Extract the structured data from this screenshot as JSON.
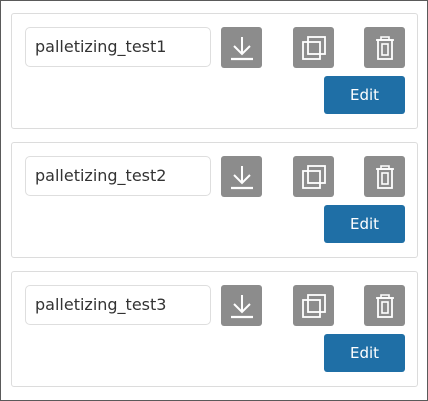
{
  "colors": {
    "icon_button_bg": "#8c8c8c",
    "edit_button_bg": "#1f6fa6",
    "icon_stroke": "#ffffff"
  },
  "icons": {
    "download": "download-icon",
    "copy": "copy-icon",
    "delete": "trash-icon"
  },
  "items": [
    {
      "name": "palletizing_test1",
      "edit_label": "Edit"
    },
    {
      "name": "palletizing_test2",
      "edit_label": "Edit"
    },
    {
      "name": "palletizing_test3",
      "edit_label": "Edit"
    }
  ]
}
